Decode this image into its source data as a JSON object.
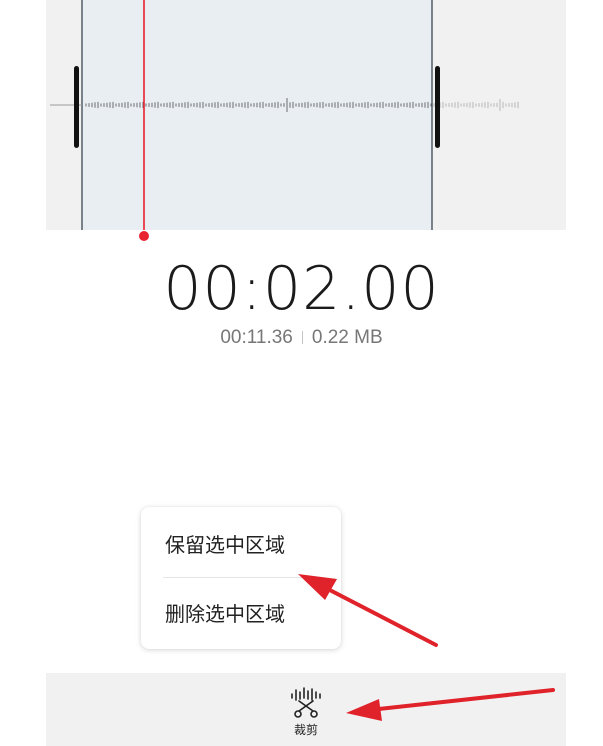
{
  "recorder": {
    "current_time": "00:02.00",
    "total_duration": "00:11.36",
    "file_size": "0.22 MB"
  },
  "menu": {
    "items": [
      {
        "label": "保留选中区域"
      },
      {
        "label": "删除选中区域"
      }
    ]
  },
  "toolbar": {
    "trim_label": "裁剪"
  },
  "colors": {
    "playhead": "#e8222e",
    "selection": "#e9eef2",
    "annotation_arrow": "#e0222a"
  }
}
